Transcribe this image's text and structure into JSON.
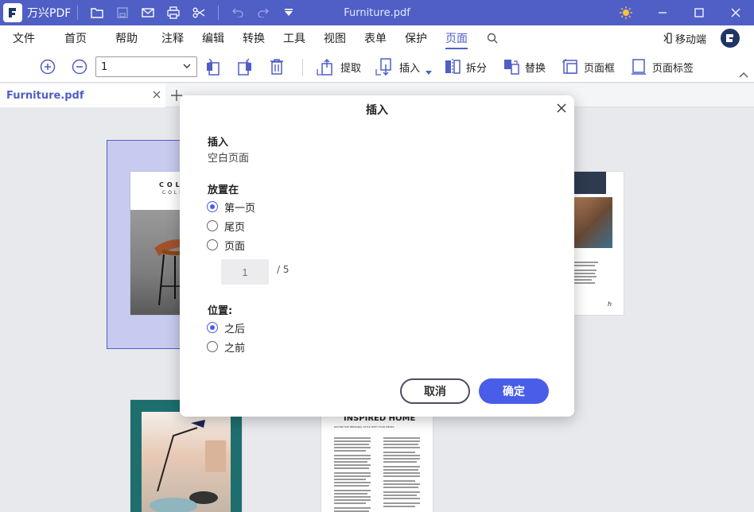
{
  "app": {
    "name": "万兴PDF",
    "document_title": "Furniture.pdf"
  },
  "titlebar": {
    "quick_access": [
      "folder-icon",
      "save-icon",
      "mail-icon",
      "print-icon",
      "scissors-icon",
      "undo-icon",
      "redo-icon",
      "dropdown-arrow-icon"
    ],
    "window_controls": [
      "theme-sun-icon",
      "minimize-icon",
      "maximize-icon",
      "close-icon"
    ]
  },
  "menu": {
    "items": [
      "文件",
      "首页",
      "帮助",
      "注释",
      "编辑",
      "转换",
      "工具",
      "视图",
      "表单",
      "保护",
      "页面"
    ],
    "active": "页面",
    "mobile_label": "移动端"
  },
  "toolbar": {
    "page_select_value": "1",
    "extract_label": "提取",
    "insert_label": "插入",
    "split_label": "拆分",
    "replace_label": "替换",
    "page_box_label": "页面框",
    "page_label_label": "页面标签"
  },
  "tabs": [
    {
      "label": "Furniture.pdf",
      "active": true
    }
  ],
  "thumbnails": {
    "page1_title": "COL",
    "page1_subtitle": "COLL",
    "page3_title": "INSPIRED HOME",
    "page3_subtitle": "DISTINCTIVE PERSONAL STYLE WITH YOUR PIECES",
    "page2_caption": "h"
  },
  "dialog": {
    "title": "插入",
    "insert_label": "插入",
    "insert_value": "空白页面",
    "place_label": "放置在",
    "place_options": [
      "第一页",
      "尾页",
      "页面"
    ],
    "place_selected": 0,
    "page_input_placeholder": "1",
    "page_total": "/ 5",
    "position_label": "位置:",
    "position_options": [
      "之后",
      "之前"
    ],
    "position_selected": 0,
    "cancel_label": "取消",
    "ok_label": "确定"
  },
  "colors": {
    "brand": "#4f5fc6",
    "primary_button": "#4a5de8",
    "selection": "#c7cbef"
  }
}
